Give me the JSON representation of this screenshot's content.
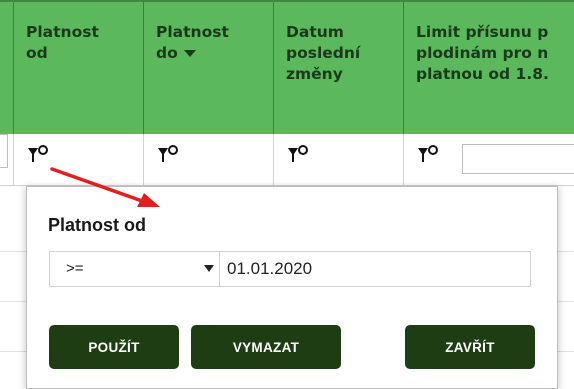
{
  "table": {
    "columns": [
      {
        "label": ""
      },
      {
        "label": "Platnost\nod"
      },
      {
        "label": "Platnost\ndo",
        "sort": "descending"
      },
      {
        "label": "Datum\nposlední\nzměny"
      },
      {
        "label": "Limit přísunu p\nplodinám pro n\nplatnou od 1.8."
      }
    ]
  },
  "filter_icons": [
    "filter-icon",
    "filter-icon",
    "filter-icon",
    "filter-icon"
  ],
  "popup": {
    "title": "Platnost od",
    "operator": ">=",
    "date_value": "01.01.2020",
    "buttons": {
      "use": "POUŽÍT",
      "clear": "VYMAZAT",
      "close": "ZAVŘÍT"
    }
  },
  "colors": {
    "header_green": "#5cb85c",
    "button_dark_green": "#1e3d12",
    "arrow_red": "#e02020"
  }
}
